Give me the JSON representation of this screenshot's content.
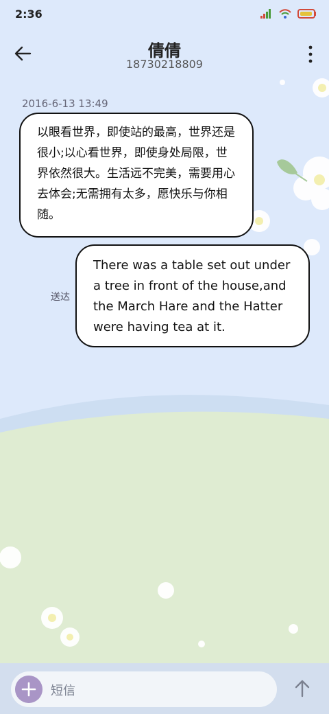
{
  "status_bar": {
    "time": "2:36"
  },
  "header": {
    "contact_name": "倩倩",
    "phone_number": "18730218809"
  },
  "conversation": {
    "timestamp": "2016-6-13 13:49",
    "incoming_message": "以眼看世界，即使站的最高，世界还是很小;以心看世界，即使身处局限，世界依然很大。生活远不完美，需要用心去体会;无需拥有太多，愿快乐与你相随。",
    "outgoing_message": "There was a table set out under a tree in front of the house,and the March Hare and the Hatter were having tea at it.",
    "delivery_status": "送达"
  },
  "composer": {
    "placeholder": "短信"
  },
  "colors": {
    "accent": "#a995c6",
    "bubble_border": "#111111",
    "sky": "#dde9fb",
    "meadow": "#dfecd2"
  }
}
